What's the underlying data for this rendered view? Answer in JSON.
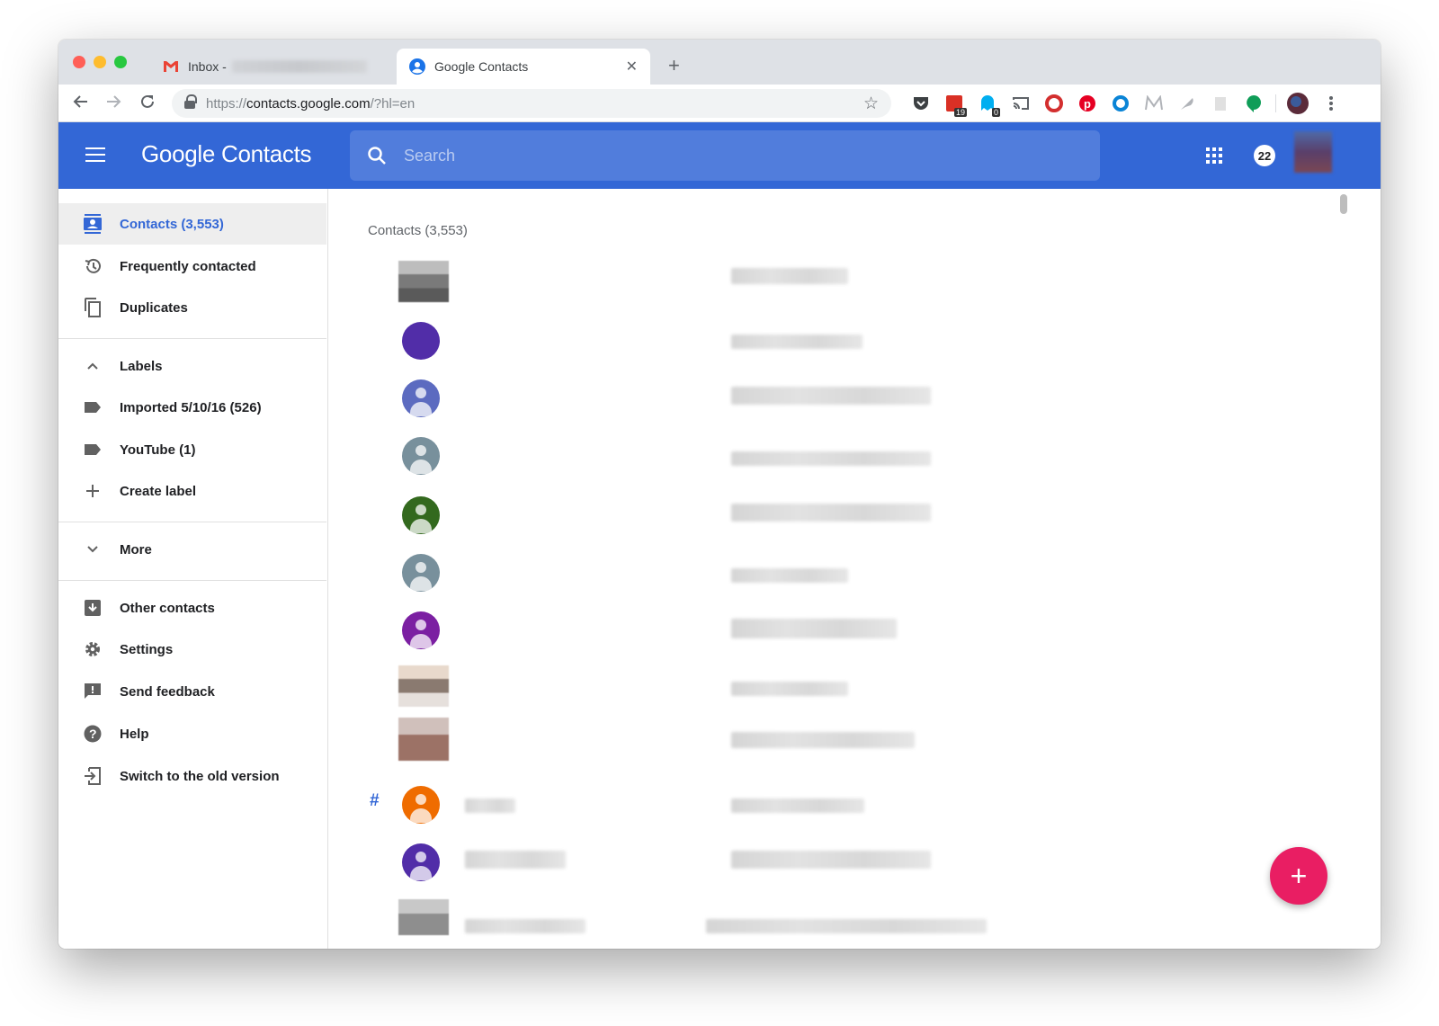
{
  "browser": {
    "tabs": [
      {
        "title": "Inbox -",
        "icon": "gmail-icon"
      },
      {
        "title": "Google Contacts",
        "icon": "contacts-icon"
      }
    ],
    "close_glyph": "✕",
    "newtab_glyph": "+",
    "url": {
      "prefix": "https://",
      "host": "contacts.google.com",
      "suffix": "/?hl=en"
    },
    "extension_badges": {
      "calendar": "19",
      "ghostery": "0"
    },
    "colors": {
      "close": "#ff5f57",
      "minimize": "#febc2e",
      "maximize": "#28c840"
    }
  },
  "header": {
    "brand_google": "Google",
    "brand_app": "Contacts",
    "search_placeholder": "Search",
    "notification_count": "22",
    "color": "#3367d6"
  },
  "sidebar": {
    "items": [
      {
        "label": "Contacts (3,553)",
        "icon": "person-card-icon",
        "active": true
      },
      {
        "label": "Frequently contacted",
        "icon": "history-icon"
      },
      {
        "label": "Duplicates",
        "icon": "copy-icon"
      },
      {
        "label": "Labels",
        "icon": "chevron-up-icon"
      },
      {
        "label": "Imported 5/10/16 (526)",
        "icon": "label-icon"
      },
      {
        "label": "YouTube (1)",
        "icon": "label-icon"
      },
      {
        "label": "Create label",
        "icon": "plus-icon"
      },
      {
        "label": "More",
        "icon": "chevron-down-icon"
      },
      {
        "label": "Other contacts",
        "icon": "archive-icon"
      },
      {
        "label": "Settings",
        "icon": "gear-icon"
      },
      {
        "label": "Send feedback",
        "icon": "feedback-icon"
      },
      {
        "label": "Help",
        "icon": "help-icon"
      },
      {
        "label": "Switch to the old version",
        "icon": "exit-icon"
      }
    ]
  },
  "main": {
    "list_title": "Contacts (3,553)",
    "section_letter": "#",
    "avatar_colors": [
      "#512da8",
      "#5c6bc0",
      "#78909c",
      "#33691e",
      "#78909c",
      "#7b1fa2",
      "#ef6c00",
      "#512da8"
    ],
    "fab_glyph": "+",
    "fab_color": "#e91e63"
  }
}
